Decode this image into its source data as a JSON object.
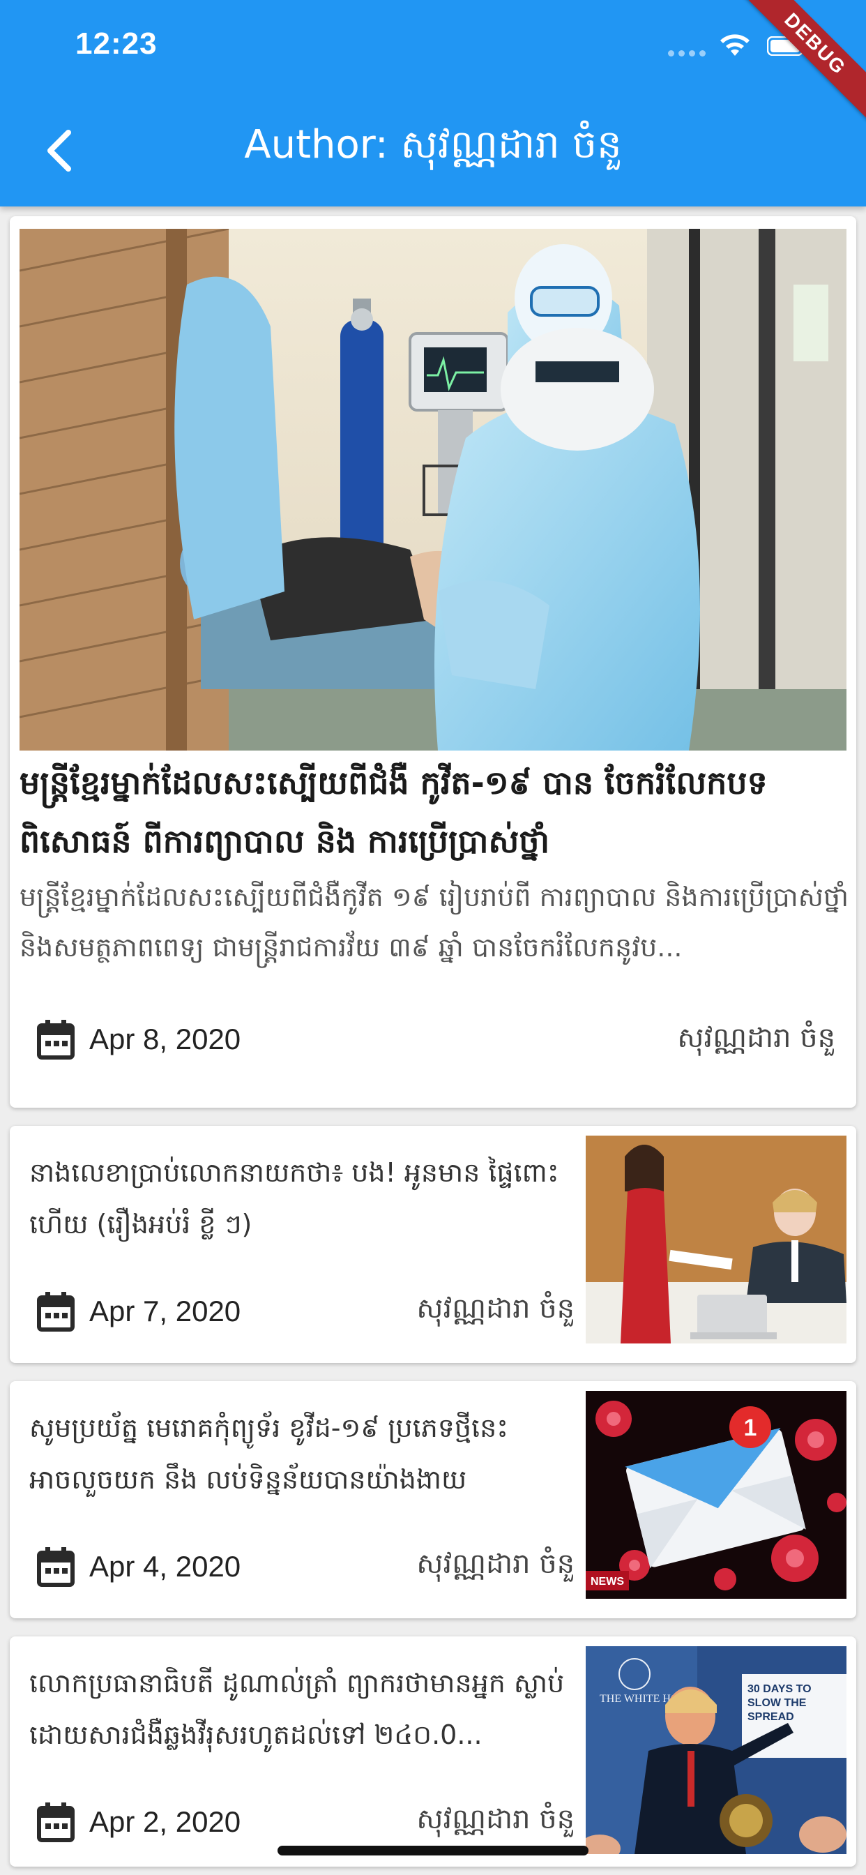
{
  "status_bar": {
    "time": "12:23"
  },
  "debug_banner": "DEBUG",
  "app_bar": {
    "title": "Author: សុវណ្ណដារា ចំនួ"
  },
  "featured": {
    "image_desc": "photo",
    "title": "មន្ត្រីខ្មែរម្នាក់ដែលសះស្បើយពីជំងឺ កូវីត-១៩ បាន ចែករំលែកបទពិសោធន៍ ពីការព្យាបាល និង ការប្រើប្រាស់ថ្នាំ",
    "summary": "មន្ត្រីខ្មែរម្នាក់ដែលសះស្បើយពីជំងឺកូវីត ១៩ រៀបរាប់ពី ការព្យាបាល និងការប្រើប្រាស់ថ្នាំ និងសមត្ថភាពពេទ្យ ជាមន្ត្រីរាជការវ័យ ៣៩ ឆ្នាំ បានចែករំលែកនូវប...",
    "date": "Apr 8, 2020",
    "author": "សុវណ្ណដារា ចំនួ"
  },
  "articles": [
    {
      "title": "នាងលេខាប្រាប់លោកនាយកថា៖ បង! អូនមាន ផ្ទៃពោះហើយ (រឿងអប់រំ ខ្លី ៗ)",
      "date": "Apr 7, 2020",
      "author": "សុវណ្ណដារា ចំនួ"
    },
    {
      "title": "សូមប្រយ័ត្ន មេរោគកុំព្យូទ័រ ខូវីដ-១៩ ប្រភេទថ្មីនេះ អាចលួចយក នឹង លប់ទិន្នន័យបានយ៉ាងងាយ",
      "date": "Apr 4, 2020",
      "author": "សុវណ្ណដារា ចំនួ",
      "badge": "1",
      "thumb_tag": "NEWS"
    },
    {
      "title": "លោកប្រធានាធិបតី ដូណាល់ត្រាំ ព្យាករថាមានអ្នក ស្លាប់ដោយសារជំងឺឆ្លងវីរុសរហូតដល់ទៅ ២៤០.0...",
      "date": "Apr 2, 2020",
      "author": "សុវណ្ណដារា ចំនួ",
      "thumb_sign": "30 DAYS TO SLOW THE SPREAD",
      "thumb_building": "THE WHITE HOUSE"
    }
  ],
  "colors": {
    "primary": "#2196f3",
    "debug": "#b0262c"
  }
}
